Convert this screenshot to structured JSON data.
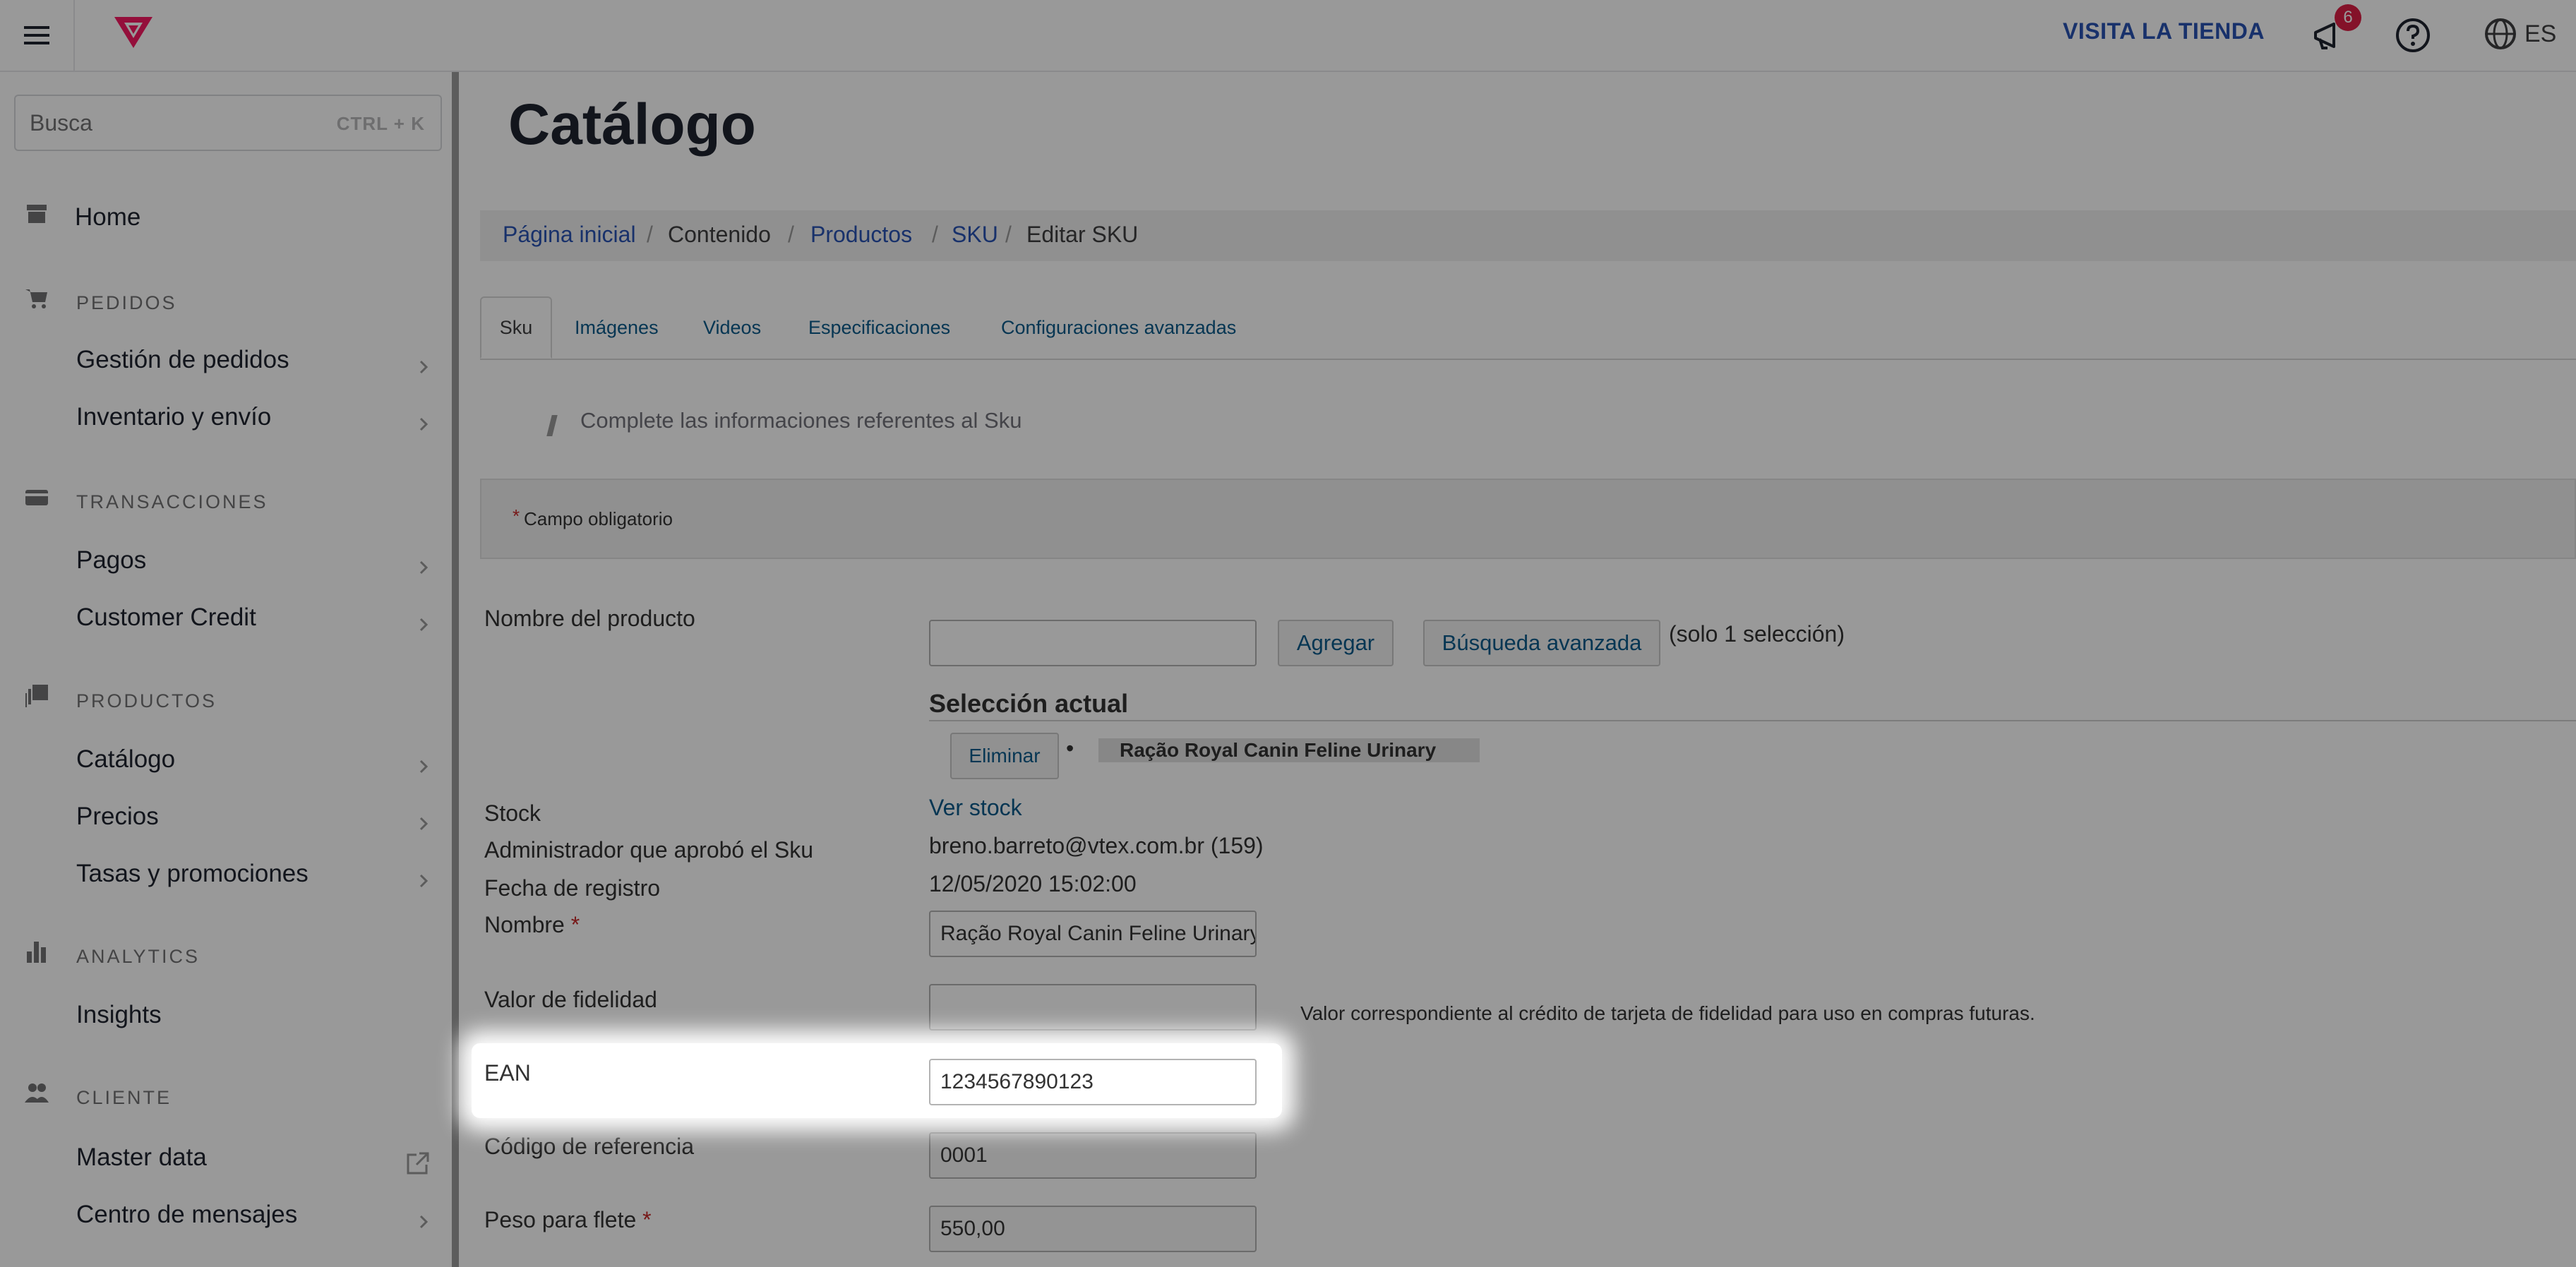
{
  "header": {
    "store_link": "VISITA LA TIENDA",
    "notifications_count": "6",
    "locale": "ES",
    "brand_color": "#f71963",
    "accent_color": "#2953b2"
  },
  "sidebar": {
    "search": {
      "placeholder": "Busca",
      "shortcut": "CTRL + K"
    },
    "home": "Home",
    "sections": [
      {
        "title": "PEDIDOS",
        "items": [
          "Gestión de pedidos",
          "Inventario y envío"
        ]
      },
      {
        "title": "TRANSACCIONES",
        "items": [
          "Pagos",
          "Customer Credit"
        ]
      },
      {
        "title": "PRODUCTOS",
        "items": [
          "Catálogo",
          "Precios",
          "Tasas y promociones"
        ]
      },
      {
        "title": "ANALYTICS",
        "items": [
          "Insights"
        ]
      },
      {
        "title": "CLIENTE",
        "items": [
          "Master data",
          "Centro de mensajes"
        ]
      }
    ]
  },
  "main": {
    "title": "Catálogo",
    "breadcrumb": [
      "Página inicial",
      "Contenido",
      "Productos",
      "SKU",
      "Editar SKU"
    ],
    "tabs": [
      "Sku",
      "Imágenes",
      "Videos",
      "Especificaciones",
      "Configuraciones avanzadas"
    ],
    "hint": "Complete las informaciones referentes al Sku",
    "required_note": "Campo obligatorio",
    "form": {
      "product_name_label": "Nombre del producto",
      "product_name_value": "",
      "add_button": "Agregar",
      "advanced_search_button": "Búsqueda avanzada",
      "selection_note": "(solo 1 selección)",
      "current_selection_title": "Selección actual",
      "remove_button": "Eliminar",
      "selected_product": "Ração Royal Canin Feline Urinary",
      "stock_label": "Stock",
      "stock_link": "Ver stock",
      "approver_label": "Administrador que aprobó el Sku",
      "approver_value": "breno.barreto@vtex.com.br (159)",
      "date_label": "Fecha de registro",
      "date_value": "12/05/2020 15:02:00",
      "name_label": "Nombre",
      "name_value": "Ração Royal Canin Feline Urinary",
      "fidelity_label": "Valor de fidelidad",
      "fidelity_value": "",
      "fidelity_help": "Valor correspondiente al crédito de tarjeta de fidelidad para uso en compras futuras.",
      "ean_label": "EAN",
      "ean_value": "1234567890123",
      "ref_label": "Código de referencia",
      "ref_value": "0001",
      "weight_label": "Peso para flete",
      "weight_value": "550,00"
    }
  }
}
